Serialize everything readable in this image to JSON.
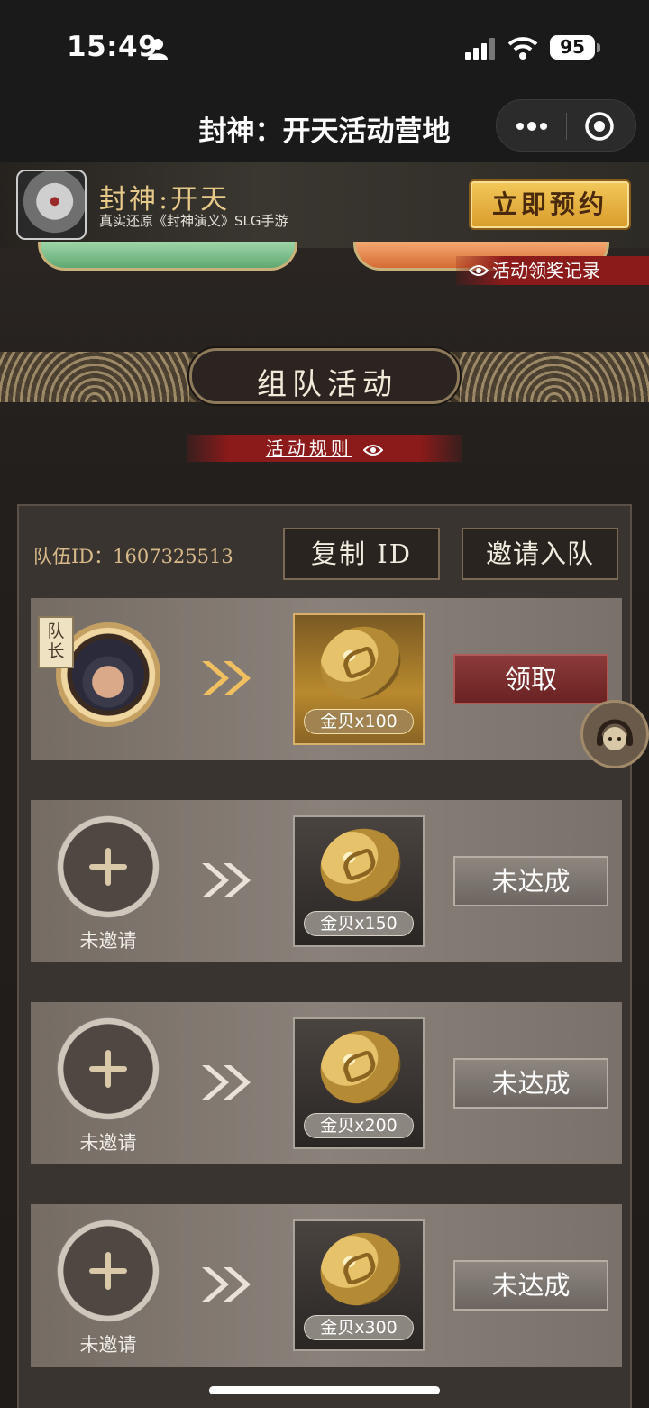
{
  "status_bar": {
    "time": "15:49",
    "battery": "95"
  },
  "nav": {
    "title": "封神：开天活动营地"
  },
  "ad": {
    "title": "封神:开天",
    "subtitle": "真实还原《封神演义》SLG手游",
    "cta": "立即预约"
  },
  "record_link": "活动领奖记录",
  "section": {
    "title": "组队活动"
  },
  "rules_link": "活动规则",
  "team": {
    "id_label": "队伍ID：1607325513",
    "copy_button": "复制 ID",
    "invite_button": "邀请入队",
    "leader_tag": "队长",
    "slots": [
      {
        "reward": "金贝x100",
        "action": "领取"
      },
      {
        "member": "未邀请",
        "reward": "金贝x150",
        "action": "未达成"
      },
      {
        "member": "未邀请",
        "reward": "金贝x200",
        "action": "未达成"
      },
      {
        "member": "未邀请",
        "reward": "金贝x300",
        "action": "未达成"
      }
    ]
  },
  "colors": {
    "accent_gold": "#d7b98a",
    "claim_red": "#7a2a2a",
    "link_red": "#8b1a1a"
  }
}
